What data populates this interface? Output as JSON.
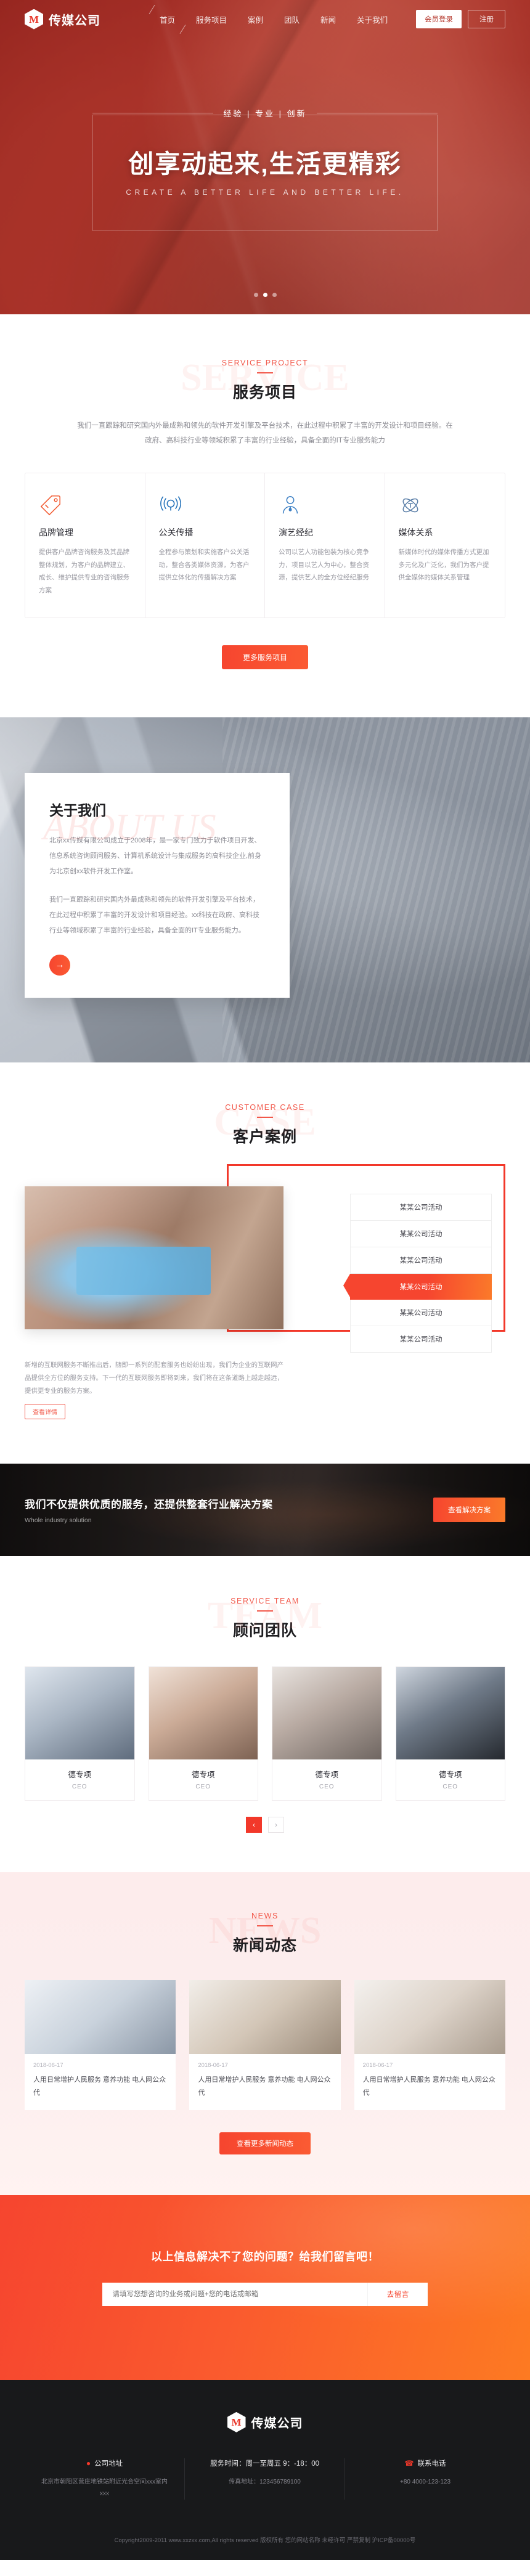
{
  "brand": {
    "name": "传媒公司",
    "logo_letter": "M"
  },
  "nav": {
    "items": [
      {
        "label": "首页",
        "active": true
      },
      {
        "label": "服务项目",
        "active": false
      },
      {
        "label": "案例",
        "active": false
      },
      {
        "label": "团队",
        "active": false
      },
      {
        "label": "新闻",
        "active": false
      },
      {
        "label": "关于我们",
        "active": false
      }
    ],
    "login_label": "会员登录",
    "register_label": "注册"
  },
  "hero": {
    "kicker": "经验 | 专业 | 创新",
    "title": "创享动起来,生活更精彩",
    "subtitle": "CREATE A BETTER LIFE AND BETTER LIFE.",
    "dots": 3,
    "active_dot": 1
  },
  "services": {
    "en": "SERVICE PROJECT",
    "cn": "服务项目",
    "ghost": "SERVICE",
    "desc": "我们一直跟踪和研究国内外最成熟和领先的软件开发引擎及平台技术，在此过程中积累了丰富的开发设计和项目经验。在政府、高科技行业等领域积累了丰富的行业经验，具备全面的IT专业服务能力",
    "more_label": "更多服务项目",
    "cards": [
      {
        "icon": "tag-icon",
        "title": "品牌管理",
        "text": "提供客户品牌咨询服务及其品牌整体规划，为客户的品牌建立、成长、维护提供专业的咨询服务方案"
      },
      {
        "icon": "broadcast-icon",
        "title": "公关传播",
        "text": "全程参与策划和实施客户公关活动，整合各类媒体资源，为客户提供立体化的传播解决方案"
      },
      {
        "icon": "artist-icon",
        "title": "演艺经纪",
        "text": "公司以艺人功能包装为核心竞争力，项目以艺人为中心，整合资源，提供艺人的全方位经纪服务"
      },
      {
        "icon": "atom-icon",
        "title": "媒体关系",
        "text": "新媒体时代的媒体传播方式更加多元化及广泛化，我们为客户提供全媒体的媒体关系管理"
      }
    ]
  },
  "about": {
    "ghost": "ABOUT US",
    "title": "关于我们",
    "paragraphs": [
      "北京xx传媒有限公司成立于2008年，是一家专门致力于软件项目开发、信息系统咨询顾问服务、计算机系统设计与集成服务的高科技企业,前身为北京创xx软件开发工作室。",
      "我们一直跟踪和研究国内外最成熟和领先的软件开发引擎及平台技术，在此过程中积累了丰富的开发设计和项目经验。xx科技在政府、高科技行业等领域积累了丰富的行业经验，具备全面的IT专业服务能力。"
    ],
    "arrow": "→"
  },
  "cases": {
    "en": "CUSTOMER CASE",
    "cn": "客户案例",
    "ghost": "CASE",
    "items": [
      {
        "label": "某某公司活动",
        "active": false
      },
      {
        "label": "某某公司活动",
        "active": false
      },
      {
        "label": "某某公司活动",
        "active": false
      },
      {
        "label": "某某公司活动",
        "active": true
      },
      {
        "label": "某某公司活动",
        "active": false
      },
      {
        "label": "某某公司活动",
        "active": false
      }
    ],
    "footer_text": "新增的互联网服务不断推出后，随即一系列的配套服务也纷纷出现，我们为企业的互联网产品提供全方位的服务支持。下一代的互联网服务即将到来，我们将在这条道路上越走越远，提供更专业的服务方案。",
    "link_label": "查看详情"
  },
  "cta": {
    "headline": "我们不仅提供优质的服务，还提供整套行业解决方案",
    "sub": "Whole industry solution",
    "button": "查看解决方案"
  },
  "team": {
    "en": "SERVICE TEAM",
    "cn": "顾问团队",
    "ghost": "TEAM",
    "members": [
      {
        "name": "德专项",
        "role": "CEO"
      },
      {
        "name": "德专项",
        "role": "CEO"
      },
      {
        "name": "德专项",
        "role": "CEO"
      },
      {
        "name": "德专项",
        "role": "CEO"
      }
    ],
    "prev": "‹",
    "next": "›"
  },
  "news": {
    "en": "NEWS",
    "cn": "新闻动态",
    "ghost": "NEWS",
    "more_label": "查看更多新闻动态",
    "items": [
      {
        "date": "2018-06-17",
        "title": "人用日常增护人民服务 意养功能 电人网公众代"
      },
      {
        "date": "2018-06-17",
        "title": "人用日常增护人民服务 意养功能 电人网公众代"
      },
      {
        "date": "2018-06-17",
        "title": "人用日常增护人民服务 意养功能 电人网公众代"
      }
    ]
  },
  "subscribe": {
    "headline": "以上信息解决不了您的问题？给我们留言吧！",
    "placeholder": "请填写您想咨询的业务或问题+您的电话或邮箱",
    "button": "去留言"
  },
  "footer": {
    "brand": "传媒公司",
    "columns": [
      {
        "icon": "location-pin-icon",
        "heading": "公司地址",
        "lines": [
          "北京市朝阳区营庄地铁站附近光合空间xxx室内xxx"
        ]
      },
      {
        "icon": "none",
        "heading": "服务时间：周一至周五 9：-18：00",
        "lines": [
          "传真地址：123456789100"
        ]
      },
      {
        "icon": "phone-icon",
        "heading": "联系电话",
        "lines": [
          "+80 4000-123-123"
        ]
      }
    ],
    "copyright": "Copyright2009-2011 www.xxzxx.com,All rights reserved 版权所有 您的网站名称 未经许可 严禁复制 沪ICP备00000号"
  }
}
